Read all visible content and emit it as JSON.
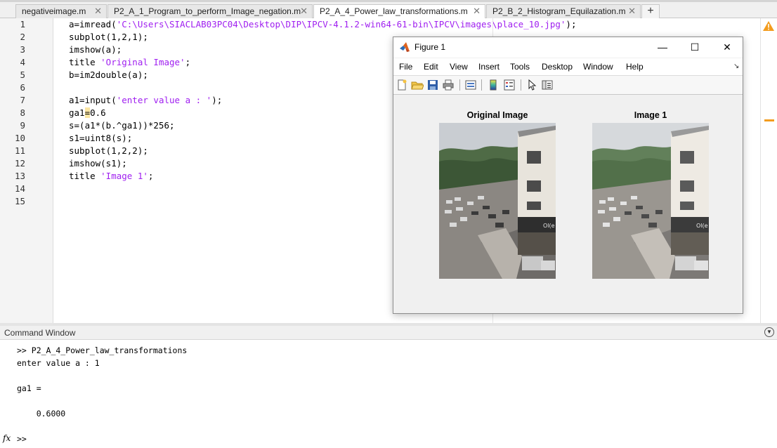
{
  "tabs": [
    {
      "label": "negativeimage.m",
      "active": false
    },
    {
      "label": "P2_A_1_Program_to_perform_Image_negation.m",
      "active": false
    },
    {
      "label": "P2_A_4_Power_law_transformations.m",
      "active": true
    },
    {
      "label": "P2_B_2_Histogram_Equilazation.m",
      "active": false
    }
  ],
  "tab_close_glyph": "✕",
  "tab_add_glyph": "+",
  "editor": {
    "line_numbers": [
      "1",
      "2",
      "3",
      "4",
      "5",
      "6",
      "7",
      "8",
      "9",
      "10",
      "11",
      "12",
      "13",
      "14",
      "15"
    ],
    "lines": [
      {
        "a": "a=imread(",
        "s": "'C:\\Users\\SIACLAB03PC04\\Desktop\\DIP\\IPCV-4.1.2-win64-61-bin\\IPCV\\images\\place_10.jpg'",
        "b": ");"
      },
      {
        "a": "subplot(1,2,1);"
      },
      {
        "a": "imshow(a);"
      },
      {
        "a": "title ",
        "s": "'Original Image'",
        "b": ";"
      },
      {
        "a": "b=im2double(a);"
      },
      {
        "a": ""
      },
      {
        "a": "a1=input(",
        "s": "'enter value a : '",
        "b": ");"
      },
      {
        "a": "ga1",
        "h": "=",
        "b": "0.6"
      },
      {
        "a": "s=(a1*(b.^ga1))*256;"
      },
      {
        "a": "s1=uint8(s);"
      },
      {
        "a": "subplot(1,2,2);"
      },
      {
        "a": "imshow(s1);"
      },
      {
        "a": "title ",
        "s": "'Image 1'",
        "b": ";"
      },
      {
        "a": ""
      },
      {
        "a": ""
      }
    ],
    "warning_icon": "warning-triangle"
  },
  "command_window": {
    "title": "Command Window",
    "lines": [
      ">> P2_A_4_Power_law_transformations",
      "enter value a : 1",
      "",
      "ga1 =",
      "",
      "    0.6000"
    ],
    "prompt": ">>",
    "fx": "fx"
  },
  "figure": {
    "title": "Figure 1",
    "window_buttons": [
      "—",
      "☐",
      "✕"
    ],
    "menu": [
      "File",
      "Edit",
      "View",
      "Insert",
      "Tools",
      "Desktop",
      "Window",
      "Help"
    ],
    "dock_glyph": "↘",
    "toolbar_icons": [
      "new-figure-icon",
      "open-file-icon",
      "save-icon",
      "print-icon",
      "link-plot-icon",
      "colorbar-icon",
      "legend-icon",
      "edit-plot-arrow-icon",
      "property-inspector-icon"
    ],
    "axes": [
      {
        "title": "Original Image",
        "image": "street-photo",
        "enhanced": false
      },
      {
        "title": "Image 1",
        "image": "street-photo",
        "enhanced": true
      }
    ],
    "photo_sign_text": "Ol(e"
  },
  "colors": {
    "string": "#a020f0",
    "highlight": "#fbe5a2",
    "warning": "#f39c1e"
  }
}
